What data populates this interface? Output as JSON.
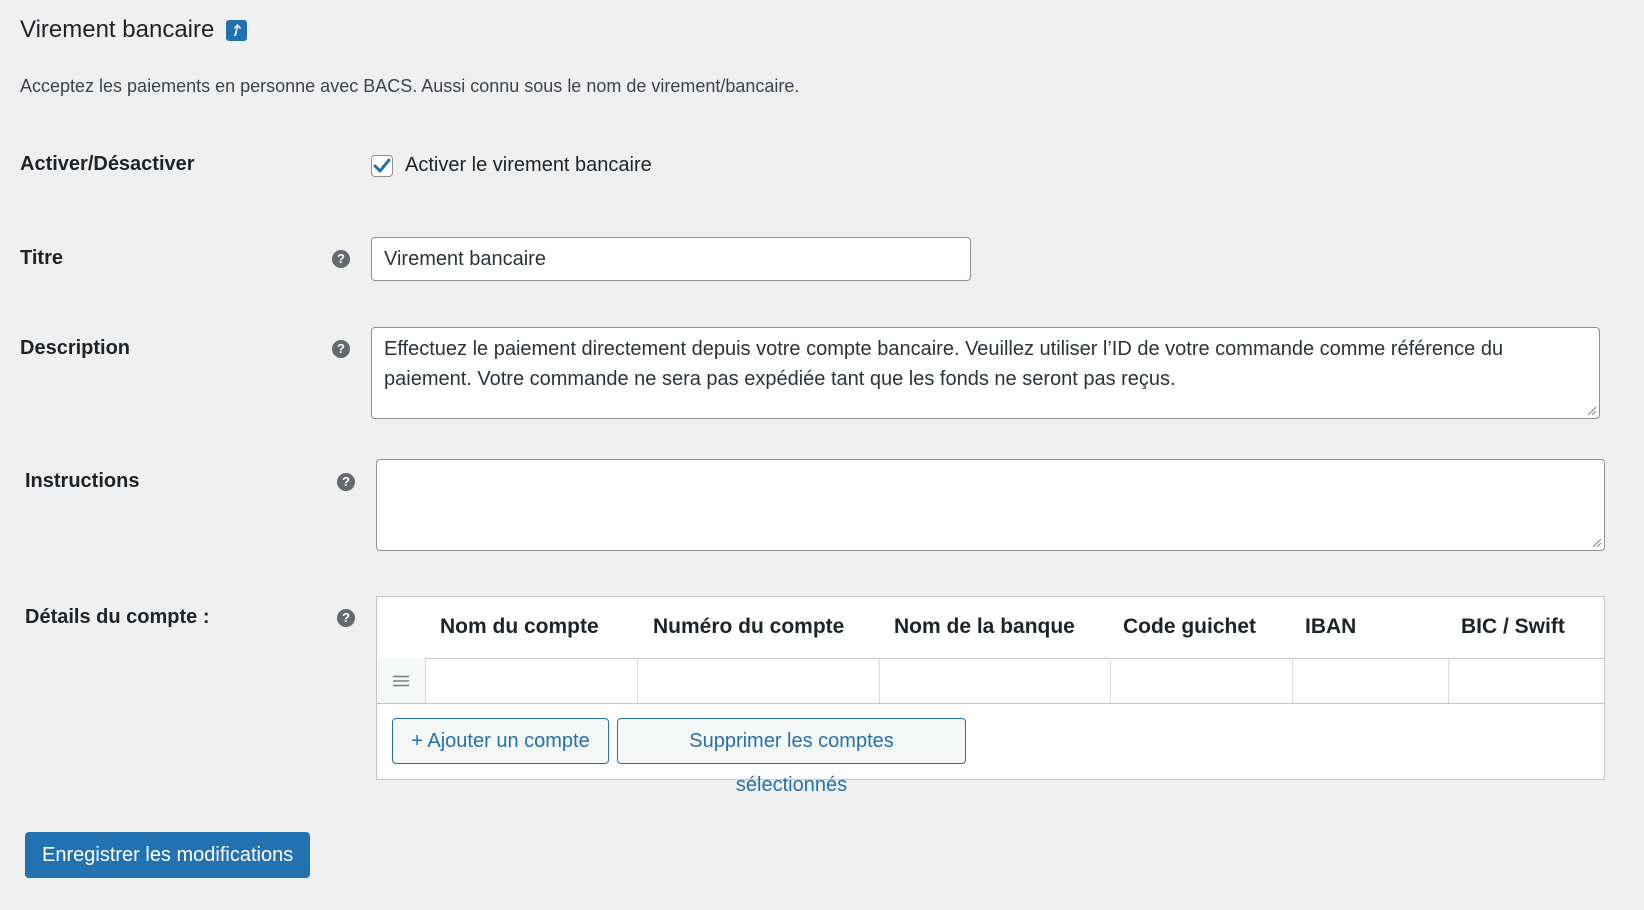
{
  "header": {
    "title": "Virement bancaire",
    "return_icon": "return-arrow-icon",
    "intro": "Acceptez les paiements en personne avec BACS. Aussi connu sous le nom de virement/bancaire."
  },
  "fields": {
    "enable": {
      "label": "Activer/Désactiver",
      "checkbox_label": "Activer le virement bancaire",
      "checked": true
    },
    "title": {
      "label": "Titre",
      "value": "Virement bancaire"
    },
    "description": {
      "label": "Description",
      "value": "Effectuez le paiement directement depuis votre compte bancaire. Veuillez utiliser l’ID de votre commande comme référence du paiement. Votre commande ne sera pas expédiée tant que les fonds ne seront pas reçus."
    },
    "instructions": {
      "label": "Instructions",
      "value": ""
    },
    "accounts": {
      "label": "Détails du compte :",
      "columns": [
        "Nom du compte",
        "Numéro du compte",
        "Nom de la banque",
        "Code guichet",
        "IBAN",
        "BIC / Swift"
      ],
      "add_button": "+ Ajouter un compte",
      "remove_button": "Supprimer les comptes sélectionnés"
    }
  },
  "footer": {
    "save_button": "Enregistrer les modifications"
  },
  "colors": {
    "accent": "#2271b1",
    "background": "#f0f0f1"
  }
}
